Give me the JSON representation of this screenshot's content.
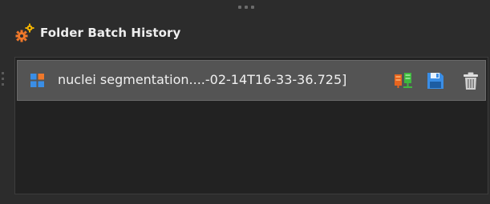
{
  "panel": {
    "title": "Folder Batch History",
    "title_icon": "gears-icon"
  },
  "history": {
    "items": [
      {
        "icon": "grid-app-icon",
        "label": "nuclei segmentation....-02-14T16-33-36.725]",
        "actions": [
          {
            "name": "run-on-cluster-button",
            "icon": "cluster-icon"
          },
          {
            "name": "save-button",
            "icon": "floppy-disk-icon"
          },
          {
            "name": "delete-button",
            "icon": "trash-icon"
          }
        ]
      }
    ]
  },
  "colors": {
    "background": "#2c2c2c",
    "list_background": "#222222",
    "row_background": "#545454",
    "accent_orange": "#f0782a",
    "accent_green": "#4cc14c",
    "accent_blue": "#3a8ee6"
  }
}
